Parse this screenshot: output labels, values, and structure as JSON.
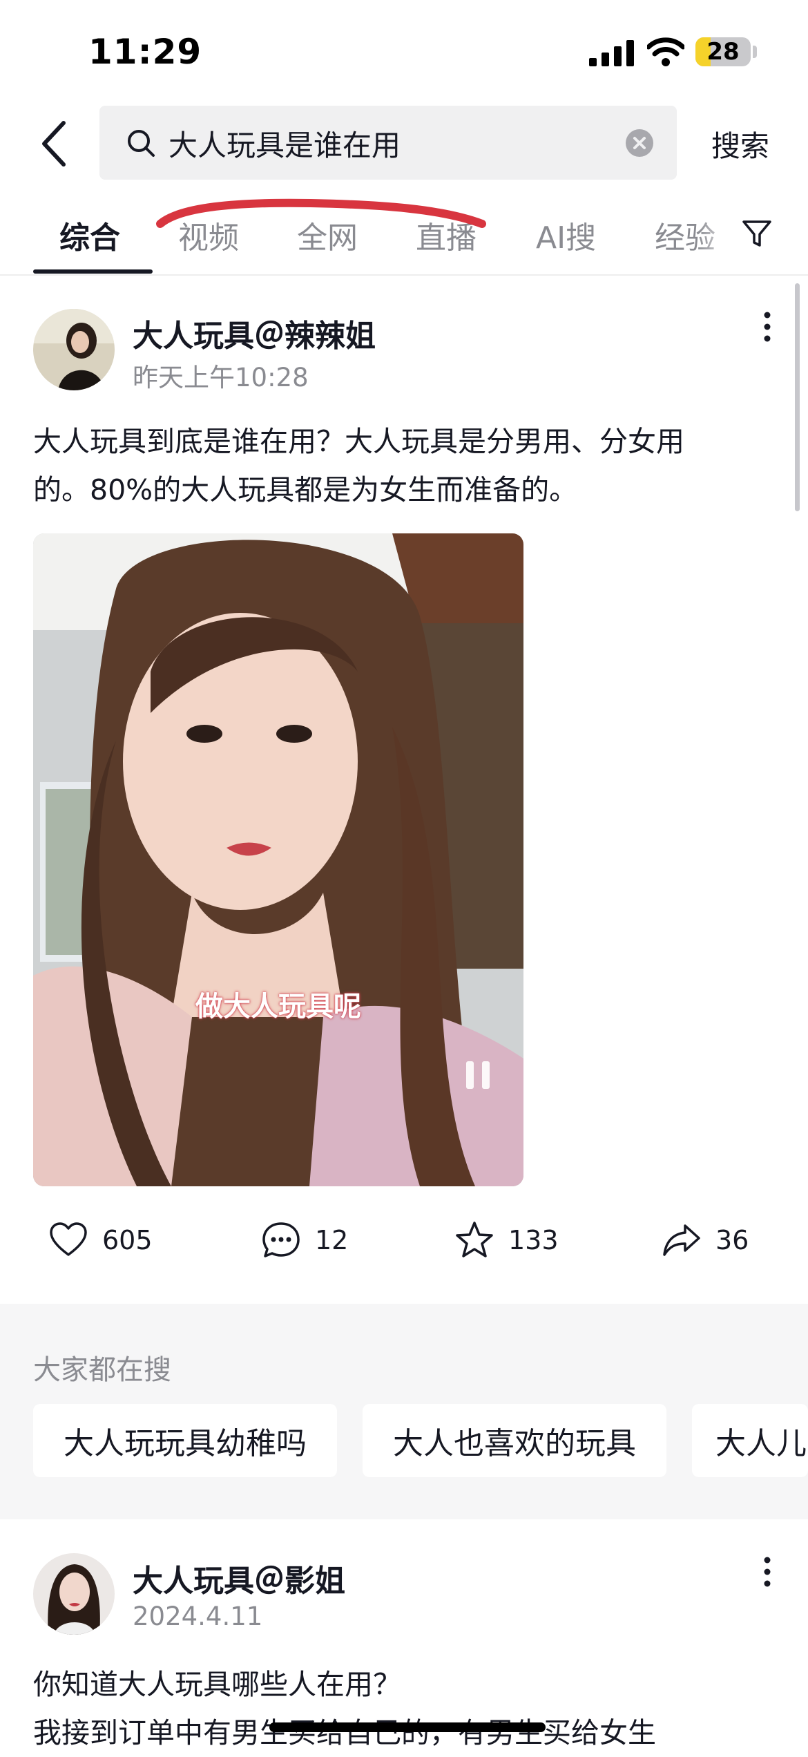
{
  "status_bar": {
    "time": "11:29",
    "battery": "28",
    "battery_level": 0.28
  },
  "search": {
    "query": "大人玩具是谁在用",
    "button_label": "搜索"
  },
  "tabs": [
    {
      "label": "综合",
      "active": true
    },
    {
      "label": "视频",
      "active": false
    },
    {
      "label": "全网",
      "active": false
    },
    {
      "label": "直播",
      "active": false
    },
    {
      "label": "AI搜",
      "active": false
    },
    {
      "label": "经验",
      "active": false
    }
  ],
  "post1": {
    "author": "大人玩具＠辣辣姐",
    "time": "昨天上午10:28",
    "text_line1": "大人玩具到底是谁在用？大人玩具是分男用、分女用",
    "text_line2": "的。80%的大人玩具都是为女生而准备的。",
    "video_caption": "做大人玩具呢",
    "likes": "605",
    "comments": "12",
    "favorites": "133",
    "shares": "36"
  },
  "hot_searches": {
    "title": "大家都在搜",
    "items": [
      "大人玩玩具幼稚吗",
      "大人也喜欢的玩具",
      "大人儿"
    ]
  },
  "post2": {
    "author": "大人玩具＠影姐",
    "time": "2024.4.11",
    "text_line1": "你知道大人玩具哪些人在用？",
    "text_line2": "我接到订单中有男生买给自己的，有男生买给女生"
  },
  "colors": {
    "annotation_red": "#d8353f",
    "battery_yellow": "#f5d22a"
  }
}
